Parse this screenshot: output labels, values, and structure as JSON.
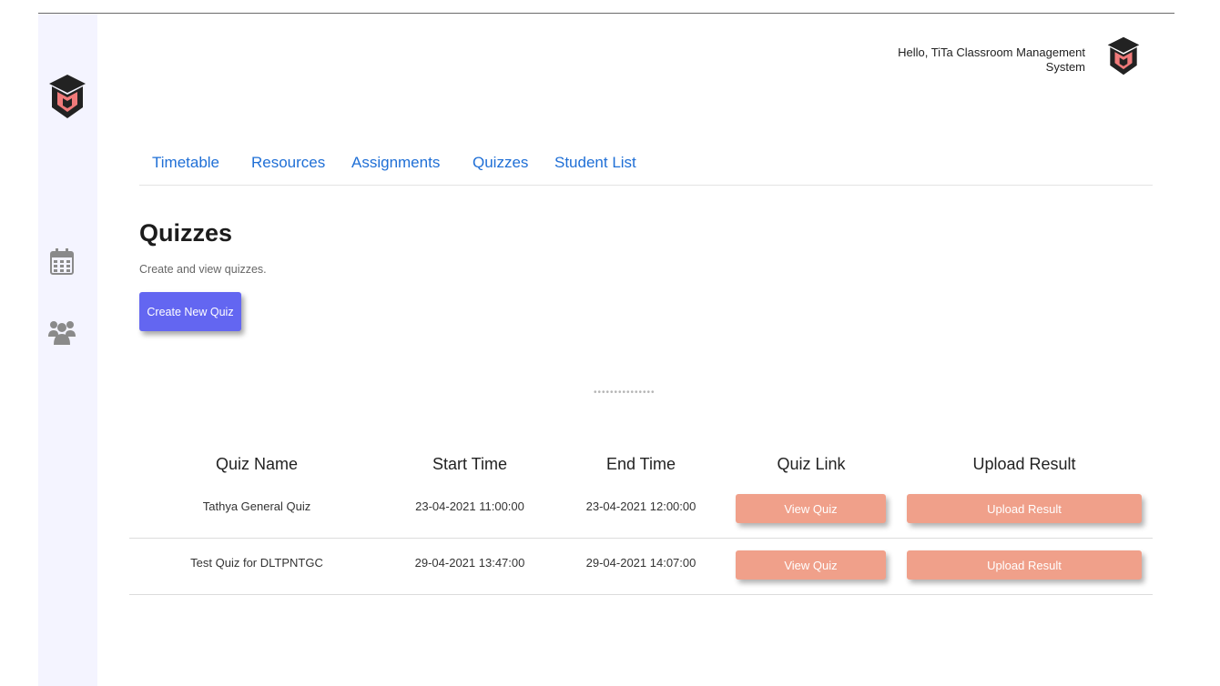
{
  "header": {
    "greeting": "Hello, TiTa Classroom Management System"
  },
  "sidebar": {
    "icons": [
      "logo-icon",
      "calendar-icon",
      "users-icon"
    ]
  },
  "nav": {
    "tabs": [
      {
        "label": "Timetable"
      },
      {
        "label": "Resources"
      },
      {
        "label": "Assignments"
      },
      {
        "label": "Quizzes"
      },
      {
        "label": "Student List"
      }
    ]
  },
  "page": {
    "title": "Quizzes",
    "subtitle": "Create and view quizzes.",
    "create_button": "Create New Quiz",
    "loader_dots": "•••••••••••••••"
  },
  "table": {
    "headers": [
      "Quiz Name",
      "Start Time",
      "End Time",
      "Quiz Link",
      "Upload Result"
    ],
    "rows": [
      {
        "name": "Tathya General Quiz",
        "start": "23-04-2021 11:00:00",
        "end": "23-04-2021 12:00:00",
        "link_label": "View Quiz",
        "upload_label": "Upload Result"
      },
      {
        "name": "Test Quiz for DLTPNTGC",
        "start": "29-04-2021 13:47:00",
        "end": "29-04-2021 14:07:00",
        "link_label": "View Quiz",
        "upload_label": "Upload Result"
      }
    ]
  },
  "colors": {
    "sidebar_bg": "#f4f4ff",
    "nav_link": "#1f6fd6",
    "primary_button": "#6366f1",
    "action_button": "#f0a08a",
    "logo_dark": "#222222",
    "logo_accent": "#f07a7a"
  }
}
